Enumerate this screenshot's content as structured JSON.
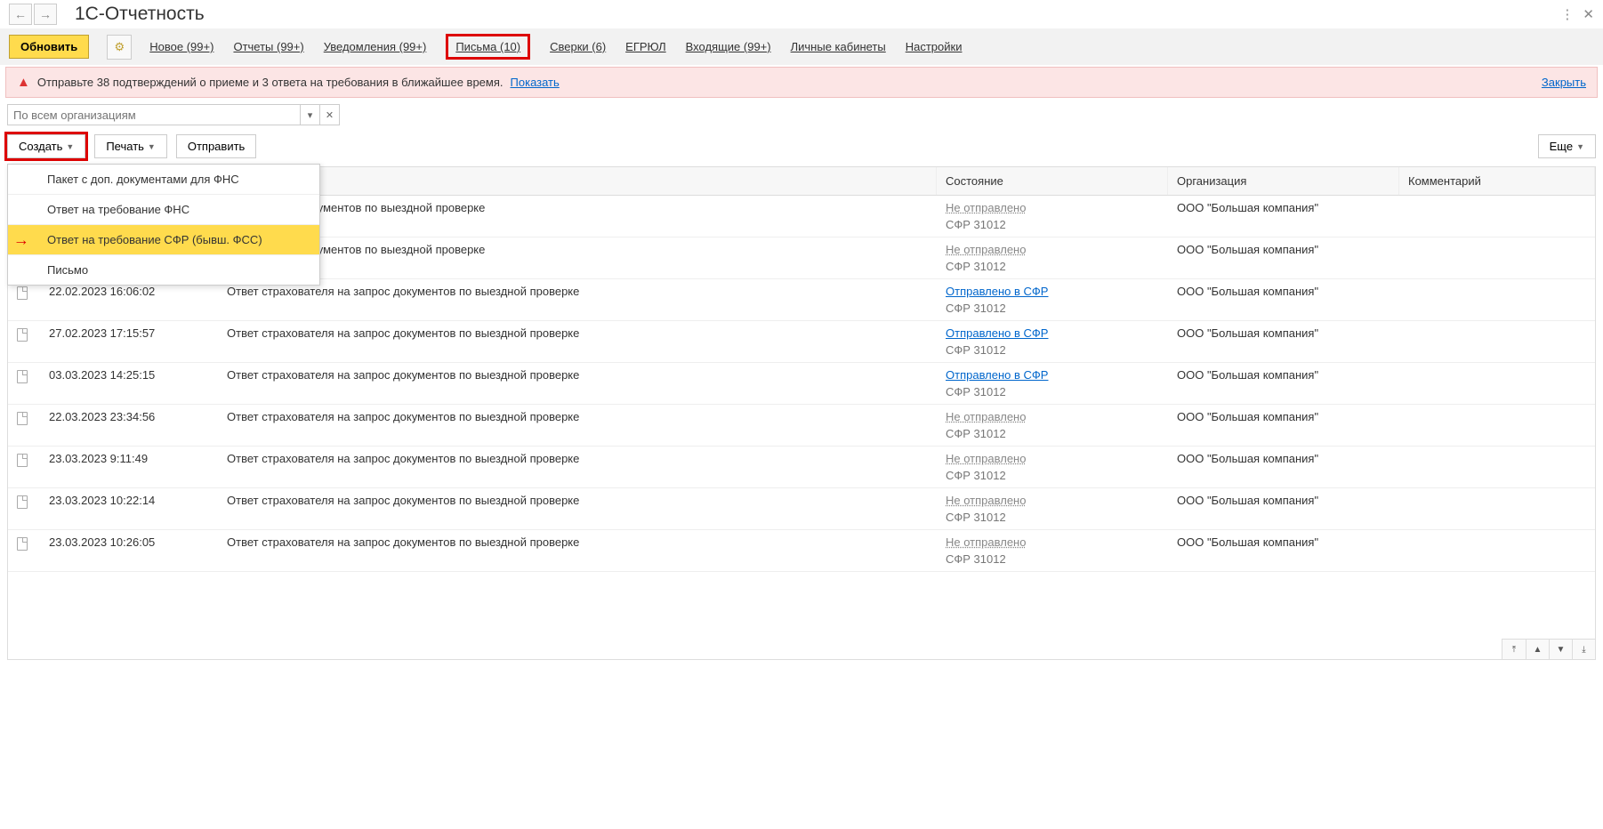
{
  "header": {
    "title": "1С-Отчетность"
  },
  "toolbar_top": {
    "refresh": "Обновить"
  },
  "tabs": {
    "new": "Новое (99+)",
    "reports": "Отчеты (99+)",
    "notifications": "Уведомления (99+)",
    "letters": "Письма (10)",
    "reconciliations": "Сверки (6)",
    "egrul": "ЕГРЮЛ",
    "incoming": "Входящие (99+)",
    "cabinets": "Личные кабинеты",
    "settings": "Настройки"
  },
  "alert": {
    "text": "Отправьте 38 подтверждений о приеме и 3 ответа на требования в ближайшее время.",
    "show": "Показать",
    "close": "Закрыть"
  },
  "filter": {
    "placeholder": "По всем организациям"
  },
  "toolbar": {
    "create": "Создать",
    "print": "Печать",
    "send": "Отправить",
    "more": "Еще"
  },
  "dropdown": {
    "item1": "Пакет с доп. документами для ФНС",
    "item2": "Ответ на требование ФНС",
    "item3": "Ответ на требование СФР (бывш. ФСС)",
    "item4": "Письмо"
  },
  "columns": {
    "state": "Состояние",
    "org": "Организация",
    "comment": "Комментарий"
  },
  "rows": [
    {
      "date": "",
      "name": "ля на запрос документов по выездной проверке",
      "state": "Не отправлено",
      "sent": false,
      "sub": "СФР 31012",
      "org": "ООО \"Большая компания\""
    },
    {
      "date": "",
      "name": "ля на запрос документов по выездной проверке",
      "state": "Не отправлено",
      "sent": false,
      "sub": "СФР 31012",
      "org": "ООО \"Большая компания\""
    },
    {
      "date": "22.02.2023 16:06:02",
      "name": "Ответ страхователя на запрос документов по выездной проверке",
      "state": "Отправлено в СФР",
      "sent": true,
      "sub": "СФР 31012",
      "org": "ООО \"Большая компания\""
    },
    {
      "date": "27.02.2023 17:15:57",
      "name": "Ответ страхователя на запрос документов по выездной проверке",
      "state": "Отправлено в СФР",
      "sent": true,
      "sub": "СФР 31012",
      "org": "ООО \"Большая компания\""
    },
    {
      "date": "03.03.2023 14:25:15",
      "name": "Ответ страхователя на запрос документов по выездной проверке",
      "state": "Отправлено в СФР",
      "sent": true,
      "sub": "СФР 31012",
      "org": "ООО \"Большая компания\""
    },
    {
      "date": "22.03.2023 23:34:56",
      "name": "Ответ страхователя на запрос документов по выездной проверке",
      "state": "Не отправлено",
      "sent": false,
      "sub": "СФР 31012",
      "org": "ООО \"Большая компания\""
    },
    {
      "date": "23.03.2023 9:11:49",
      "name": "Ответ страхователя на запрос документов по выездной проверке",
      "state": "Не отправлено",
      "sent": false,
      "sub": "СФР 31012",
      "org": "ООО \"Большая компания\""
    },
    {
      "date": "23.03.2023 10:22:14",
      "name": "Ответ страхователя на запрос документов по выездной проверке",
      "state": "Не отправлено",
      "sent": false,
      "sub": "СФР 31012",
      "org": "ООО \"Большая компания\""
    },
    {
      "date": "23.03.2023 10:26:05",
      "name": "Ответ страхователя на запрос документов по выездной проверке",
      "state": "Не отправлено",
      "sent": false,
      "sub": "СФР 31012",
      "org": "ООО \"Большая компания\""
    }
  ]
}
